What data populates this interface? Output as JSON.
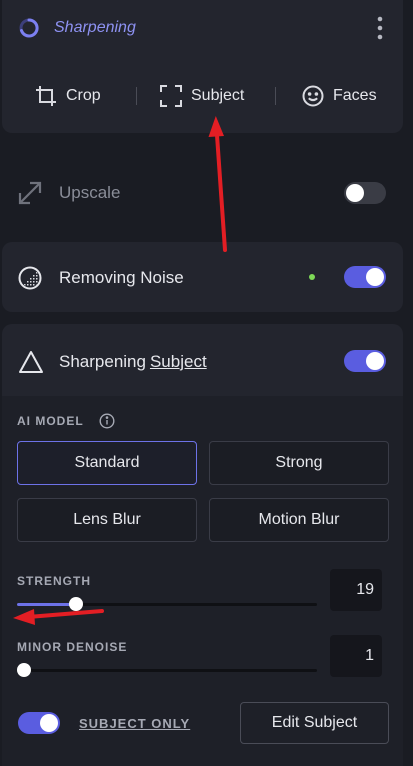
{
  "header": {
    "title": "Sharpening",
    "menu_icon": "more-vertical-icon"
  },
  "mode_tabs": [
    {
      "label": "Crop",
      "icon": "crop-icon"
    },
    {
      "label": "Subject",
      "icon": "focus-frame-icon"
    },
    {
      "label": "Faces",
      "icon": "smiley-face-icon"
    }
  ],
  "upscale": {
    "label": "Upscale",
    "enabled": false
  },
  "removing_noise": {
    "label": "Removing Noise",
    "enabled": true,
    "status_color": "#7ed957"
  },
  "sharpening": {
    "label_prefix": "Sharpening",
    "label_link": "Subject",
    "enabled": true,
    "ai_model_label": "AI MODEL",
    "models": [
      "Standard",
      "Strong",
      "Lens Blur",
      "Motion Blur"
    ],
    "selected_model": "Standard",
    "strength_label": "STRENGTH",
    "strength_value": "19",
    "minor_denoise_label": "MINOR DENOISE",
    "minor_denoise_value": "1",
    "subject_only_label": "SUBJECT ONLY",
    "subject_only_enabled": true,
    "edit_subject_label": "Edit Subject"
  },
  "colors": {
    "accent": "#6d72e8",
    "annotation_arrow": "#e31e24"
  }
}
